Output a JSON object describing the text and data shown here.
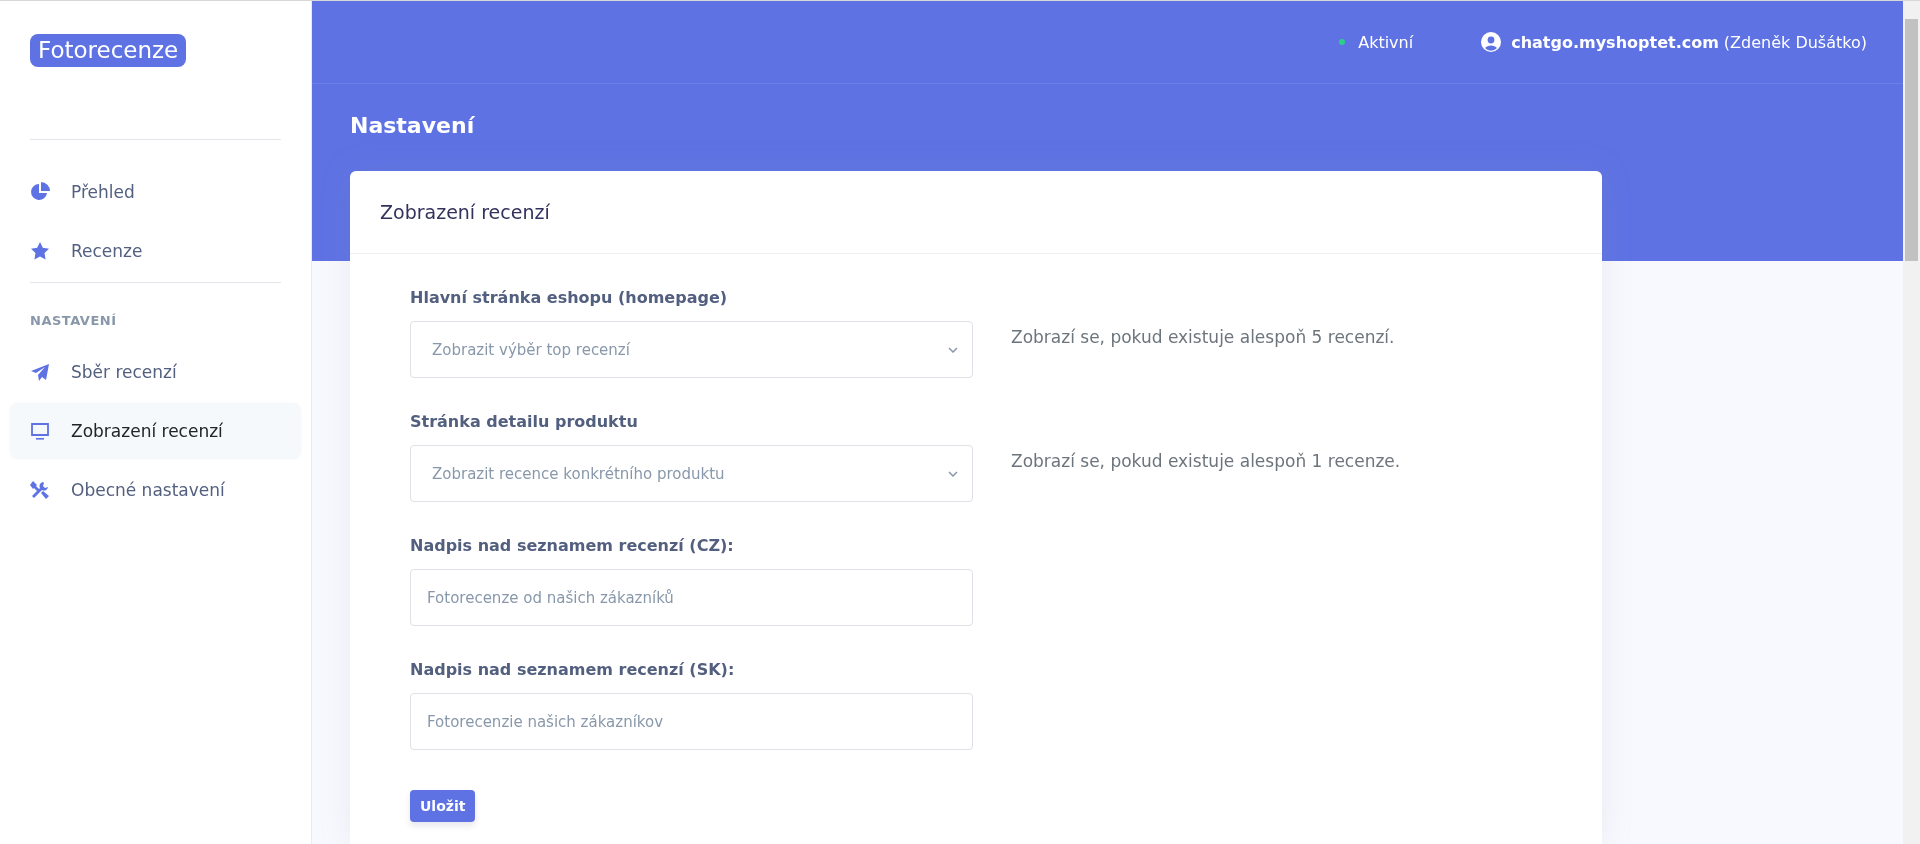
{
  "sidebar": {
    "logo": "Fotorecenze",
    "groups": [
      {
        "items": [
          {
            "label": "Přehled",
            "selected": false
          },
          {
            "label": "Recenze",
            "selected": false
          }
        ]
      },
      {
        "heading": "NASTAVENÍ",
        "items": [
          {
            "label": "Sběr recenzí",
            "selected": false
          },
          {
            "label": "Zobrazení recenzí",
            "selected": true
          },
          {
            "label": "Obecné nastavení",
            "selected": false
          }
        ]
      }
    ]
  },
  "topbar": {
    "status": {
      "label": "Aktivní",
      "color": "#2dce89"
    },
    "account": {
      "shop": "chatgo.myshoptet.com",
      "user": "(Zdeněk Dušátko)"
    }
  },
  "page_title": "Nastavení",
  "card": {
    "title": "Zobrazení recenzí",
    "fields": [
      {
        "kind": "select",
        "label": "Hlavní stránka eshopu (homepage)",
        "value": "Zobrazit výběr top recenzí",
        "help": "Zobrazí se, pokud existuje alespoň 5 recenzí."
      },
      {
        "kind": "select",
        "label": "Stránka detailu produktu",
        "value": "Zobrazit recence konkrétního produktu",
        "help": "Zobrazí se, pokud existuje alespoň 1 recenze."
      },
      {
        "kind": "text",
        "label": "Nadpis nad seznamem recenzí (CZ):",
        "placeholder": "Fotorecenze od našich zákazníků"
      },
      {
        "kind": "text",
        "label": "Nadpis nad seznamem recenzí (SK):",
        "placeholder": "Fotorecenzie našich zákazníkov"
      }
    ],
    "save_button": "Uložit"
  }
}
